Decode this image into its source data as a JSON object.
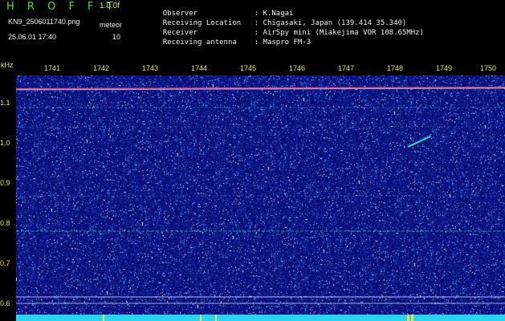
{
  "header": {
    "title": "H R O F F T",
    "version": "1.0.0f",
    "filename": "KN9_2506011740.png",
    "mode_label": "meteor",
    "datetime": "25.06.01 17:40",
    "mode_value": "10",
    "info": [
      {
        "label": "Observer",
        "value": ": K.Nagai"
      },
      {
        "label": "Receiving Location",
        "value": ": Chigasaki, Japan (139.414 35.340)"
      },
      {
        "label": "Receiver",
        "value": ": AirSpy mini (Miakejima VOR 108.65MHz)"
      },
      {
        "label": "Receiving antenna",
        "value": ": Maspro FM-3"
      }
    ]
  },
  "axis": {
    "unit": "kHz",
    "minutes": [
      "1741",
      "1742",
      "1743",
      "1744",
      "1745",
      "1746",
      "1747",
      "1748",
      "1749",
      "1750"
    ],
    "freq_labels": [
      "1.1",
      "1.0",
      "0.9",
      "0.8",
      "0.7",
      "0.6"
    ]
  },
  "colors": {
    "background": "#000000",
    "spectrogram_base": "#0a0a6e",
    "title": "#5ad34a",
    "axis_text": "#e8e84a",
    "info_text": "#f0f0f0",
    "carrier": "#ff4a6a",
    "bottom_bar": "#27d4f2"
  }
}
